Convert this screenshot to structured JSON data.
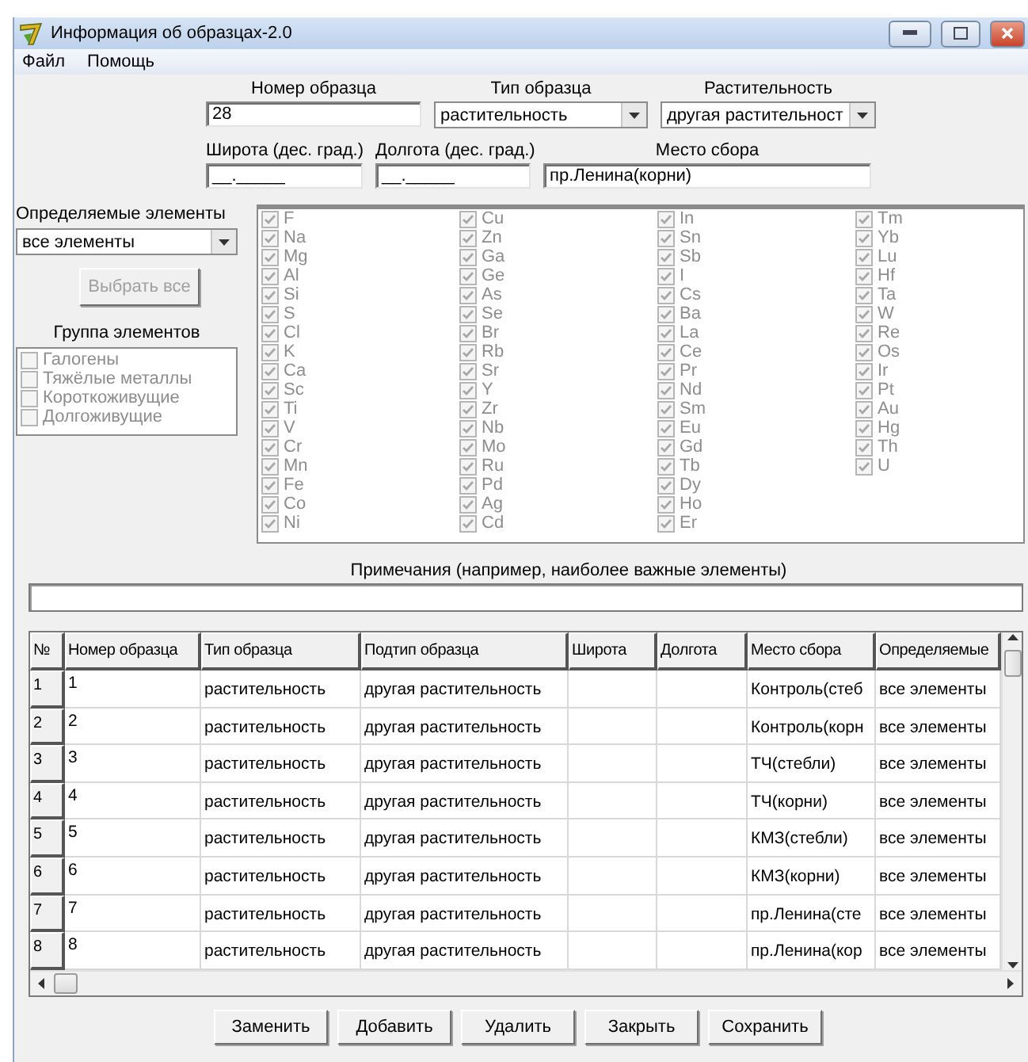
{
  "window": {
    "title": "Информация об образцах-2.0"
  },
  "menu": [
    {
      "label": "Файл"
    },
    {
      "label": "Помощь"
    }
  ],
  "form": {
    "sample_number": {
      "label": "Номер образца",
      "value": "28"
    },
    "sample_type": {
      "label": "Тип образца",
      "value": "растительность"
    },
    "vegetation": {
      "label": "Растительность",
      "value": "другая растительност"
    },
    "latitude": {
      "label": "Широта (дес. град.)",
      "value": "__._____"
    },
    "longitude": {
      "label": "Долгота (дес. град.)",
      "value": "__._____"
    },
    "place": {
      "label": "Место сбора",
      "value": "пр.Ленина(корни)"
    }
  },
  "element_selector": {
    "label": "Определяемые элементы",
    "value": "все элементы",
    "button": {
      "label": "Выбрать все",
      "disabled": true
    }
  },
  "element_groups": {
    "label": "Группа элементов",
    "items": [
      {
        "label": "Галогены",
        "checked": false,
        "disabled": true
      },
      {
        "label": "Тяжёлые металлы",
        "checked": false,
        "disabled": true
      },
      {
        "label": "Короткоживущие",
        "checked": false,
        "disabled": true
      },
      {
        "label": "Долгоживущие",
        "checked": false,
        "disabled": true
      }
    ]
  },
  "elements": {
    "disabled": true,
    "columns": [
      [
        {
          "symbol": "F",
          "checked": true
        },
        {
          "symbol": "Na",
          "checked": true
        },
        {
          "symbol": "Mg",
          "checked": true
        },
        {
          "symbol": "Al",
          "checked": true
        },
        {
          "symbol": "Si",
          "checked": true
        },
        {
          "symbol": "S",
          "checked": true
        },
        {
          "symbol": "Cl",
          "checked": true
        },
        {
          "symbol": "K",
          "checked": true
        },
        {
          "symbol": "Ca",
          "checked": true
        },
        {
          "symbol": "Sc",
          "checked": true
        },
        {
          "symbol": "Ti",
          "checked": true
        },
        {
          "symbol": "V",
          "checked": true
        },
        {
          "symbol": "Cr",
          "checked": true
        },
        {
          "symbol": "Mn",
          "checked": true
        },
        {
          "symbol": "Fe",
          "checked": true
        },
        {
          "symbol": "Co",
          "checked": true
        },
        {
          "symbol": "Ni",
          "checked": true
        }
      ],
      [
        {
          "symbol": "Cu",
          "checked": true
        },
        {
          "symbol": "Zn",
          "checked": true
        },
        {
          "symbol": "Ga",
          "checked": true
        },
        {
          "symbol": "Ge",
          "checked": true
        },
        {
          "symbol": "As",
          "checked": true
        },
        {
          "symbol": "Se",
          "checked": true
        },
        {
          "symbol": "Br",
          "checked": true
        },
        {
          "symbol": "Rb",
          "checked": true
        },
        {
          "symbol": "Sr",
          "checked": true
        },
        {
          "symbol": "Y",
          "checked": true
        },
        {
          "symbol": "Zr",
          "checked": true
        },
        {
          "symbol": "Nb",
          "checked": true
        },
        {
          "symbol": "Mo",
          "checked": true
        },
        {
          "symbol": "Ru",
          "checked": true
        },
        {
          "symbol": "Pd",
          "checked": true
        },
        {
          "symbol": "Ag",
          "checked": true
        },
        {
          "symbol": "Cd",
          "checked": true
        }
      ],
      [
        {
          "symbol": "In",
          "checked": true
        },
        {
          "symbol": "Sn",
          "checked": true
        },
        {
          "symbol": "Sb",
          "checked": true
        },
        {
          "symbol": "I",
          "checked": true
        },
        {
          "symbol": "Cs",
          "checked": true
        },
        {
          "symbol": "Ba",
          "checked": true
        },
        {
          "symbol": "La",
          "checked": true
        },
        {
          "symbol": "Ce",
          "checked": true
        },
        {
          "symbol": "Pr",
          "checked": true
        },
        {
          "symbol": "Nd",
          "checked": true
        },
        {
          "symbol": "Sm",
          "checked": true
        },
        {
          "symbol": "Eu",
          "checked": true
        },
        {
          "symbol": "Gd",
          "checked": true
        },
        {
          "symbol": "Tb",
          "checked": true
        },
        {
          "symbol": "Dy",
          "checked": true
        },
        {
          "symbol": "Ho",
          "checked": true
        },
        {
          "symbol": "Er",
          "checked": true
        }
      ],
      [
        {
          "symbol": "Tm",
          "checked": true
        },
        {
          "symbol": "Yb",
          "checked": true
        },
        {
          "symbol": "Lu",
          "checked": true
        },
        {
          "symbol": "Hf",
          "checked": true
        },
        {
          "symbol": "Ta",
          "checked": true
        },
        {
          "symbol": "W",
          "checked": true
        },
        {
          "symbol": "Re",
          "checked": true
        },
        {
          "symbol": "Os",
          "checked": true
        },
        {
          "symbol": "Ir",
          "checked": true
        },
        {
          "symbol": "Pt",
          "checked": true
        },
        {
          "symbol": "Au",
          "checked": true
        },
        {
          "symbol": "Hg",
          "checked": true
        },
        {
          "symbol": "Th",
          "checked": true
        },
        {
          "symbol": "U",
          "checked": true
        }
      ]
    ]
  },
  "notes": {
    "label": "Примечания (например, наиболее важные элементы)"
  },
  "table": {
    "columns": [
      "№",
      "Номер образца",
      "Тип образца",
      "Подтип образца",
      "Широта",
      "Долгота",
      "Место сбора",
      "Определяемые"
    ],
    "rows": [
      {
        "cells": [
          "1",
          "1",
          "растительность",
          "другая растительность",
          "",
          "",
          "Контроль(стеб",
          "все элементы"
        ]
      },
      {
        "cells": [
          "2",
          "2",
          "растительность",
          "другая растительность",
          "",
          "",
          "Контроль(корн",
          "все элементы"
        ]
      },
      {
        "cells": [
          "3",
          "3",
          "растительность",
          "другая растительность",
          "",
          "",
          "ТЧ(стебли)",
          "все элементы"
        ]
      },
      {
        "cells": [
          "4",
          "4",
          "растительность",
          "другая растительность",
          "",
          "",
          "ТЧ(корни)",
          "все элементы"
        ]
      },
      {
        "cells": [
          "5",
          "5",
          "растительность",
          "другая растительность",
          "",
          "",
          "КМЗ(стебли)",
          "все элементы"
        ]
      },
      {
        "cells": [
          "6",
          "6",
          "растительность",
          "другая растительность",
          "",
          "",
          "КМЗ(корни)",
          "все элементы"
        ]
      },
      {
        "cells": [
          "7",
          "7",
          "растительность",
          "другая растительность",
          "",
          "",
          "пр.Ленина(сте",
          "все элементы"
        ]
      },
      {
        "cells": [
          "8",
          "8",
          "растительность",
          "другая растительность",
          "",
          "",
          "пр.Ленина(кор",
          "все элементы"
        ]
      }
    ]
  },
  "buttons": [
    {
      "label": "Заменить"
    },
    {
      "label": "Добавить"
    },
    {
      "label": "Удалить"
    },
    {
      "label": "Закрыть"
    },
    {
      "label": "Сохранить"
    }
  ]
}
